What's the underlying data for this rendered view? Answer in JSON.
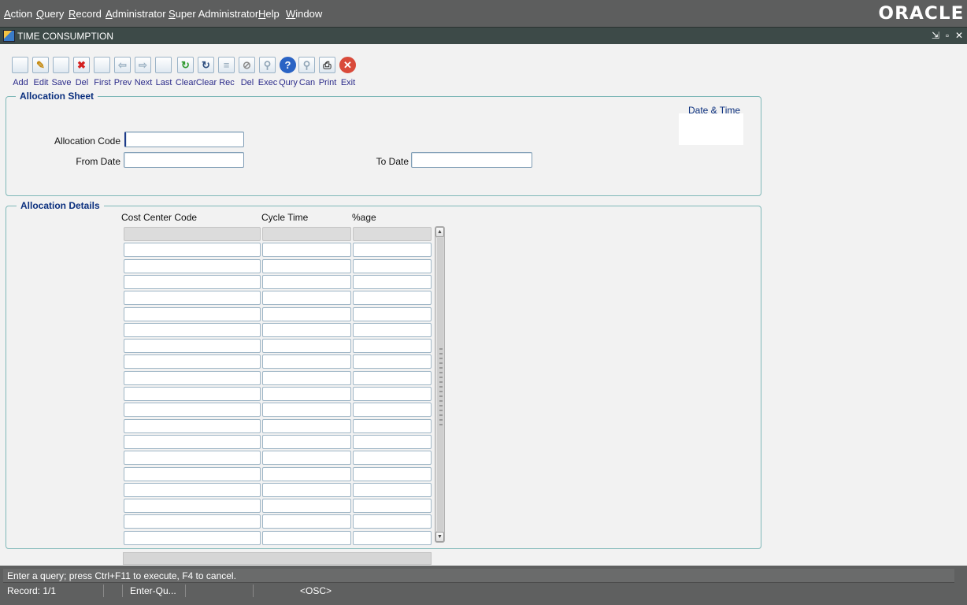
{
  "menubar": {
    "items": [
      "Action",
      "Query",
      "Record",
      "Administrator",
      "Super Administrator",
      "Help",
      "Window"
    ],
    "logo": "ORACLE"
  },
  "window": {
    "title": "TIME CONSUMPTION",
    "controls": {
      "minimize": "⇲",
      "restore": "▫",
      "close": "✕"
    }
  },
  "toolbar": {
    "buttons": [
      {
        "label": "Add",
        "icon": "add-icon",
        "glyph": "",
        "color": "#7a8fa3"
      },
      {
        "label": "Edit",
        "icon": "edit-icon",
        "glyph": "✎",
        "color": "#c58a12"
      },
      {
        "label": "Save",
        "icon": "save-icon",
        "glyph": "",
        "color": "#7a8fa3"
      },
      {
        "label": "Del",
        "icon": "delete-icon",
        "glyph": "✖",
        "color": "#d42020"
      },
      {
        "label": "First",
        "icon": "first-icon",
        "glyph": "",
        "color": "#9ab0c2"
      },
      {
        "label": "Prev",
        "icon": "prev-icon",
        "glyph": "⇦",
        "color": "#9ab0c2"
      },
      {
        "label": "Next",
        "icon": "next-icon",
        "glyph": "⇨",
        "color": "#9ab0c2"
      },
      {
        "label": "Last",
        "icon": "last-icon",
        "glyph": "",
        "color": "#9ab0c2"
      },
      {
        "label": "Clear",
        "icon": "clear-icon",
        "glyph": "↻",
        "color": "#2e9a2e"
      },
      {
        "label": "Clear",
        "icon": "clear-record-icon",
        "glyph": "↻",
        "color": "#2f4f7f"
      },
      {
        "label": "Rec",
        "icon": "record-icon",
        "glyph": "≡",
        "color": "#8fa4b6"
      },
      {
        "label": "Del",
        "icon": "delete-record-icon",
        "glyph": "⊘",
        "color": "#8a8a8a"
      },
      {
        "label": "Exec",
        "icon": "execute-query-icon",
        "glyph": "⚲",
        "color": "#8fa4b6"
      },
      {
        "label": "Qury",
        "icon": "query-help-icon",
        "glyph": "?",
        "color": "#ffffff",
        "bg": "#2a63c4"
      },
      {
        "label": "Can",
        "icon": "cancel-query-icon",
        "glyph": "⚲",
        "color": "#8fa4b6"
      },
      {
        "label": "Print",
        "icon": "print-icon",
        "glyph": "⎙",
        "color": "#333333"
      },
      {
        "label": "Exit",
        "icon": "exit-icon",
        "glyph": "✕",
        "color": "#ffffff",
        "bg": "#d94a3a"
      }
    ]
  },
  "allocation_sheet": {
    "title": "Allocation Sheet",
    "date_time_label": "Date & Time",
    "allocation_code_label": "Allocation Code",
    "allocation_code_value": "",
    "from_date_label": "From Date",
    "from_date_value": "",
    "to_date_label": "To Date",
    "to_date_value": ""
  },
  "allocation_details": {
    "title": "Allocation Details",
    "columns": [
      "Cost Center Code",
      "Cycle Time",
      "%age"
    ]
  },
  "status": {
    "message": "Enter a query;  press Ctrl+F11 to execute, F4 to cancel.",
    "segments": [
      "Record: 1/1",
      "",
      "Enter-Qu...",
      "",
      "<OSC>"
    ]
  }
}
